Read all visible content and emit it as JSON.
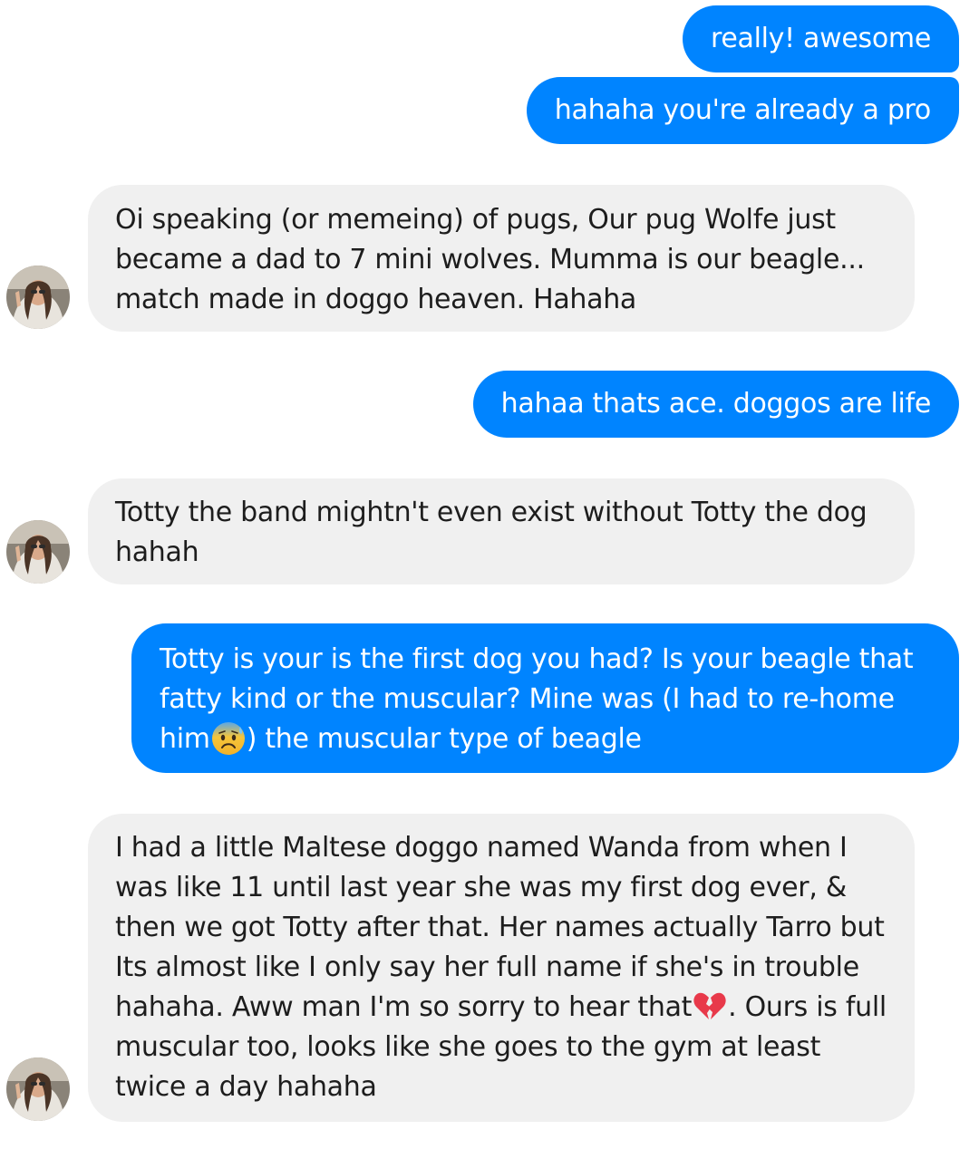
{
  "messages": [
    {
      "from": "me",
      "lines": [
        "really! awesome"
      ]
    },
    {
      "from": "me",
      "lines": [
        "hahaha you're already a pro"
      ]
    },
    {
      "from": "them",
      "lines": [
        "Oi speaking (or memeing) of pugs, Our pug Wolfe just",
        "became a dad to 7 mini wolves. Mumma is our beagle...",
        "match made in doggo heaven. Hahaha"
      ]
    },
    {
      "from": "me",
      "lines": [
        "hahaa thats ace. doggos are life"
      ]
    },
    {
      "from": "them",
      "lines": [
        "Totty the band mightn't even exist without Totty the dog",
        "hahah"
      ]
    },
    {
      "from": "me",
      "lines": [
        "Totty is your is the first dog you had? Is your beagle that",
        "fatty kind or the muscular? Mine was (I had to re-home",
        "him",
        ") the muscular type of beagle"
      ],
      "emoji": "anxious-face-emoji"
    },
    {
      "from": "them",
      "lines": [
        "I had a little Maltese doggo named Wanda from when I",
        "was like 11 until last year she was my first dog ever, &",
        "then we got Totty after that. Her names actually Tarro but",
        "Its almost like I only say her full name if she's in trouble",
        "hahaha. Aww man I'm so sorry to hear that",
        ". Ours is full",
        "muscular too, looks like she goes to the gym at least",
        "twice a day hahaha"
      ],
      "emoji": "broken-heart-emoji"
    }
  ],
  "colors": {
    "outgoing_bubble": "#0084ff",
    "incoming_bubble": "#f0f0f0"
  }
}
